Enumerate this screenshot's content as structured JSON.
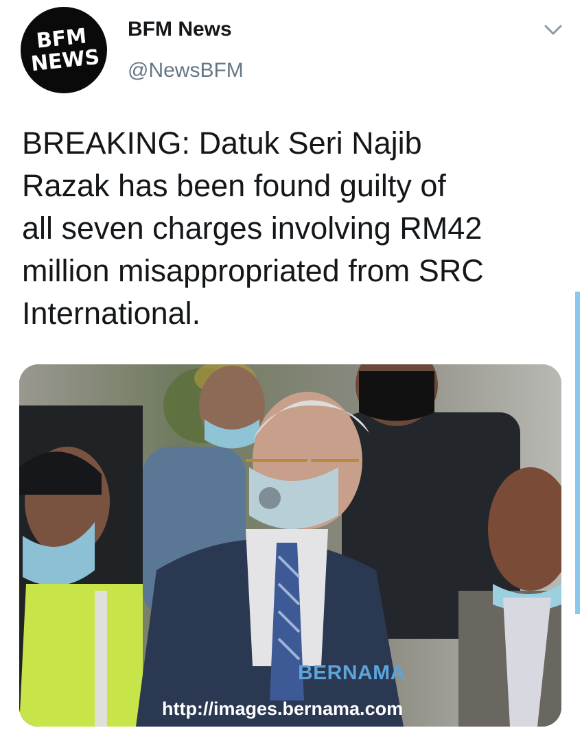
{
  "account": {
    "avatar_line1": "BFM",
    "avatar_line2": "NEWS",
    "name": "BFM News",
    "handle": "@NewsBFM"
  },
  "tweet": {
    "text_lines": [
      "BREAKING: Datuk Seri Najib",
      "Razak has been found guilty of",
      "all seven charges involving RM42",
      "million misappropriated from SRC",
      "International."
    ]
  },
  "media": {
    "watermark": "BERNAMA",
    "source_url": "http://images.bernama.com"
  },
  "icons": {
    "menu": "chevron-down-icon"
  },
  "colors": {
    "text": "#14171a",
    "secondary": "#657786",
    "scroll_indicator": "#8cc7ee",
    "watermark": "#5ba4dc"
  }
}
